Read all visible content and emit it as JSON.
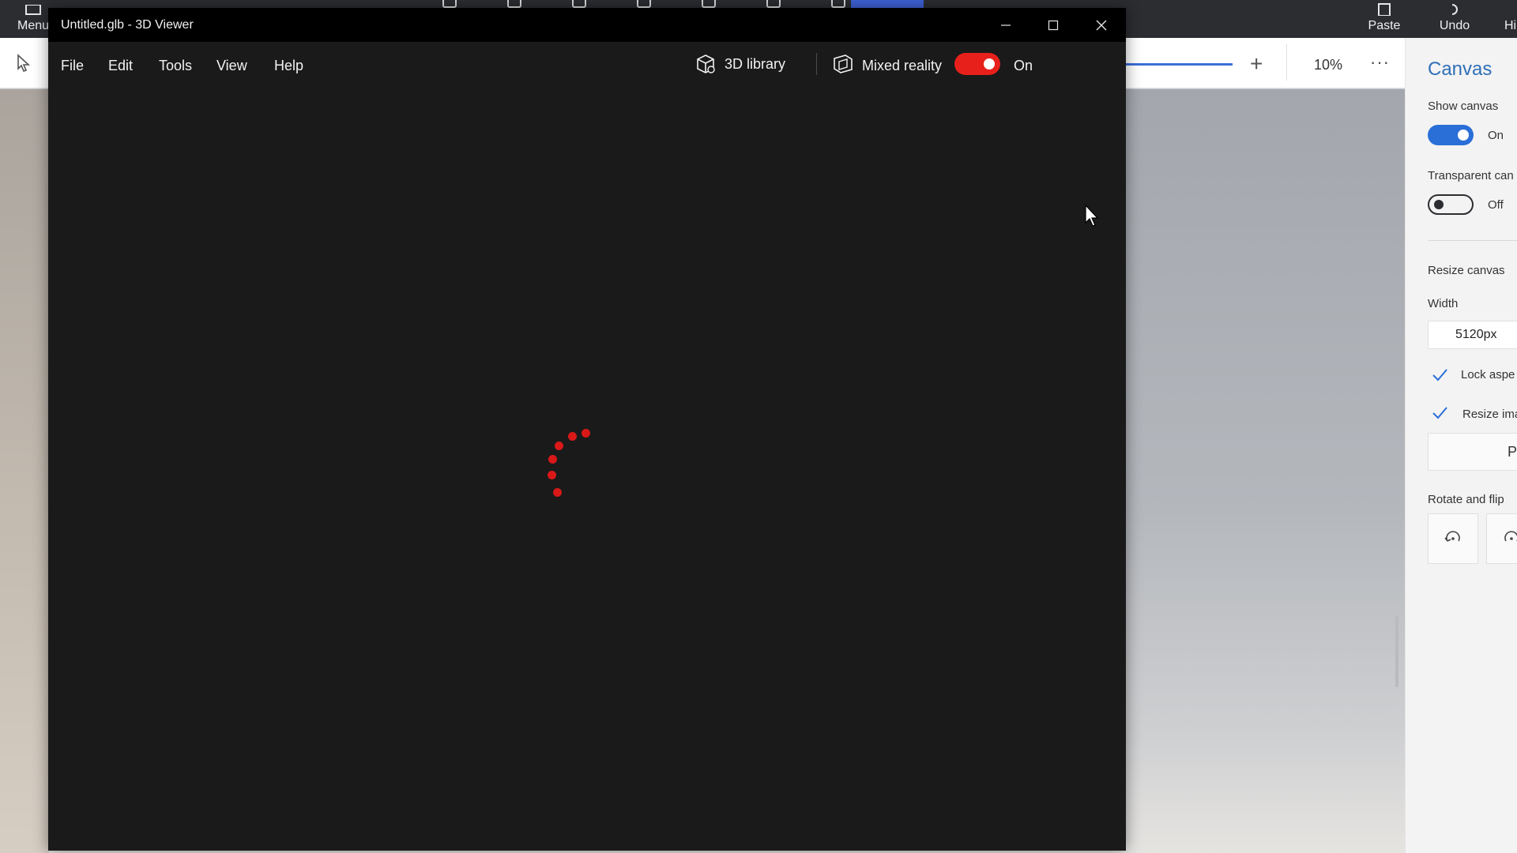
{
  "background_app": {
    "topbar": {
      "menu_label": "Menu",
      "paste_label": "Paste",
      "undo_label": "Undo",
      "history_label_partial": "Hi"
    },
    "zoom_level": "10%",
    "more_glyph": "···",
    "panel": {
      "title": "Canvas",
      "show_canvas_label": "Show canvas",
      "show_canvas_state": "On",
      "show_canvas_on": true,
      "transparent_canvas_label": "Transparent can",
      "transparent_canvas_state": "Off",
      "transparent_canvas_on": false,
      "resize_canvas_label": "Resize canvas",
      "width_label": "Width",
      "width_value": "5120px",
      "lock_aspect_label": "Lock aspe",
      "lock_aspect_checked": true,
      "resize_image_label": "Resize ima",
      "resize_image_checked": true,
      "preset_button_partial": "P",
      "rotate_flip_label": "Rotate and flip"
    },
    "accent_color": "#2a6fd8"
  },
  "viewer": {
    "title": "Untitled.glb - 3D Viewer",
    "window_controls": [
      "minimize-icon",
      "maximize-icon",
      "close-icon"
    ],
    "menu": [
      "File",
      "Edit",
      "Tools",
      "View",
      "Help"
    ],
    "library_label": "3D library",
    "mixed_reality_label": "Mixed reality",
    "mixed_reality_state": "On",
    "mixed_reality_on": true,
    "toggle_color": "#e8201b",
    "loading_indicator_color": "#d91818"
  }
}
